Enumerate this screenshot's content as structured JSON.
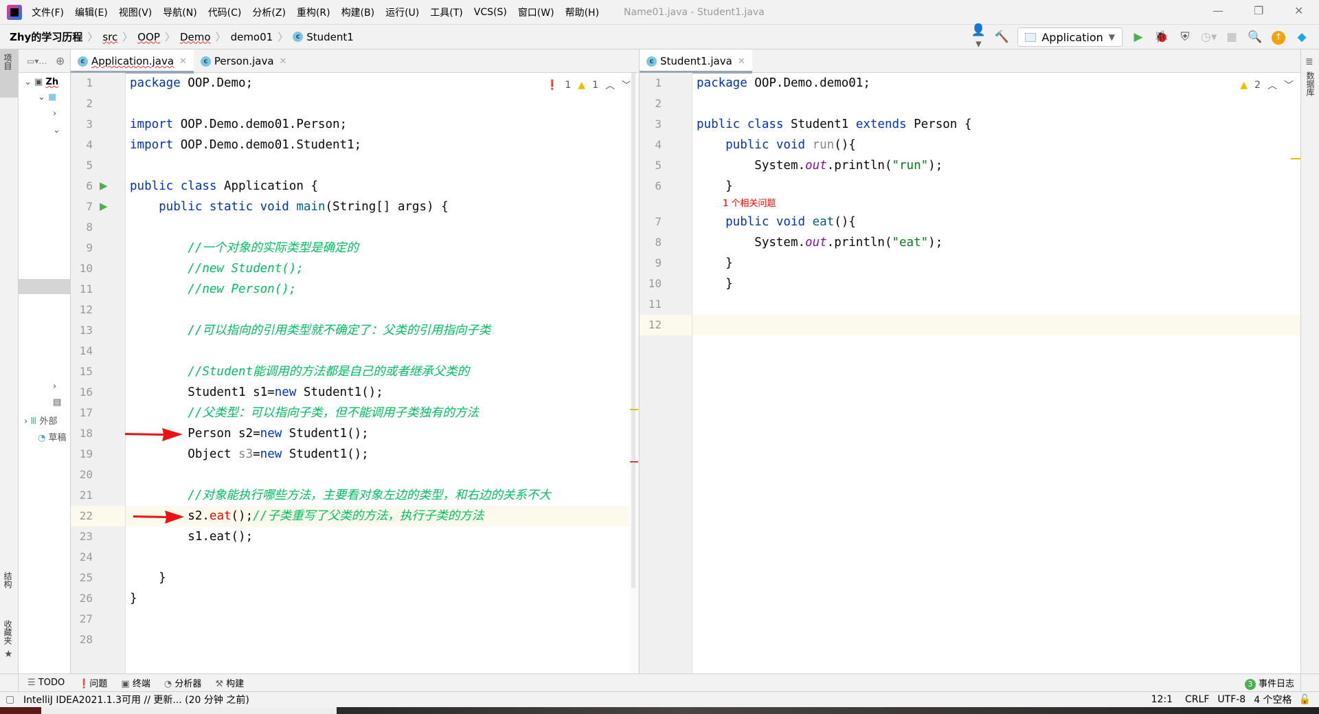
{
  "menu": {
    "items": [
      "文件(F)",
      "编辑(E)",
      "视图(V)",
      "导航(N)",
      "代码(C)",
      "分析(Z)",
      "重构(R)",
      "构建(B)",
      "运行(U)",
      "工具(T)",
      "VCS(S)",
      "窗口(W)",
      "帮助(H)"
    ],
    "window_title": "Name01.java - Student1.java"
  },
  "breadcrumb": [
    "Zhy的学习历程",
    "src",
    "OOP",
    "Demo",
    "demo01",
    "Student1"
  ],
  "toolbar": {
    "run_config": "Application",
    "icons": [
      "user-icon",
      "build-hammer-icon",
      "run-icon",
      "debug-icon",
      "coverage-icon",
      "profile-icon",
      "stop-icon",
      "search-icon",
      "update-icon",
      "toolbox-icon"
    ]
  },
  "left_strip": {
    "project": "项目",
    "structure": "结构",
    "favorites": "收藏夹"
  },
  "right_strip": {
    "database": "数据库"
  },
  "project_tree": {
    "root": "Zh",
    "external": "外部",
    "scratch": "草稿"
  },
  "left_editor": {
    "tabs": [
      {
        "label": "Application.java",
        "active": true
      },
      {
        "label": "Person.java",
        "active": false
      }
    ],
    "errors": "1",
    "warnings": "1",
    "current_line": 22,
    "arrow_lines": [
      18,
      22
    ],
    "lines": [
      [
        [
          "package",
          "kw"
        ],
        [
          " OOP.Demo;",
          ""
        ]
      ],
      [],
      [
        [
          "import",
          "kw"
        ],
        [
          " OOP.Demo.demo01.Person;",
          ""
        ]
      ],
      [
        [
          "import",
          "kw"
        ],
        [
          " OOP.Demo.demo01.Student1;",
          ""
        ]
      ],
      [],
      [
        [
          "public class",
          "kw"
        ],
        [
          " Application {",
          ""
        ]
      ],
      [
        [
          "    public static void",
          "kw"
        ],
        [
          " ",
          ""
        ],
        [
          "main",
          "fn"
        ],
        [
          "(String[] args) {",
          ""
        ]
      ],
      [],
      [
        [
          "        //一个对象的实际类型是确定的",
          "cm"
        ]
      ],
      [
        [
          "        //new Student();",
          "cm"
        ]
      ],
      [
        [
          "        //new Person();",
          "cm"
        ]
      ],
      [],
      [
        [
          "        //可以指向的引用类型就不确定了：父类的引用指向子类",
          "cm"
        ]
      ],
      [],
      [
        [
          "        //Student能调用的方法都是自己的或者继承父类的",
          "cm"
        ]
      ],
      [
        [
          "        Student1 s1=",
          ""
        ],
        [
          "new",
          "kw"
        ],
        [
          " Student1();",
          ""
        ]
      ],
      [
        [
          "        //父类型：可以指向子类，但不能调用子类独有的方法",
          "cm"
        ]
      ],
      [
        [
          "        Person s2=",
          ""
        ],
        [
          "new",
          "kw"
        ],
        [
          " Student1();",
          ""
        ]
      ],
      [
        [
          "        Object ",
          ""
        ],
        [
          "s3",
          "gray"
        ],
        [
          "=",
          ""
        ],
        [
          "new",
          "kw"
        ],
        [
          " Student1();",
          ""
        ]
      ],
      [],
      [
        [
          "        //对象能执行哪些方法，主要看对象左边的类型，和右边的关系不大",
          "cm"
        ]
      ],
      [
        [
          "        s2.",
          ""
        ],
        [
          "eat",
          "red"
        ],
        [
          "();",
          ""
        ],
        [
          "//子类重写了父类的方法，执行子类的方法",
          "cm"
        ]
      ],
      [
        [
          "        s1.eat();",
          ""
        ]
      ],
      [],
      [
        [
          "    }",
          ""
        ]
      ],
      [
        [
          "}",
          ""
        ]
      ],
      [],
      []
    ]
  },
  "right_editor": {
    "tabs": [
      {
        "label": "Student1.java",
        "active": true
      }
    ],
    "warnings": "2",
    "current_line": 12,
    "related_problems": "1 个相关问题",
    "lines": [
      [
        [
          "package",
          "kw"
        ],
        [
          " OOP.Demo.demo01;",
          ""
        ]
      ],
      [],
      [
        [
          "public class",
          "kw"
        ],
        [
          " Student1 ",
          ""
        ],
        [
          "extends",
          "kw"
        ],
        [
          " Person {",
          ""
        ]
      ],
      [
        [
          "    public void",
          "kw"
        ],
        [
          " ",
          ""
        ],
        [
          "run",
          "gray"
        ],
        [
          "(){",
          ""
        ]
      ],
      [
        [
          "        System.",
          ""
        ],
        [
          "out",
          "it"
        ],
        [
          ".println(",
          ""
        ],
        [
          "\"run\"",
          "st"
        ],
        [
          ");",
          ""
        ]
      ],
      [
        [
          "    }",
          ""
        ]
      ],
      [
        [
          "    public void",
          "kw"
        ],
        [
          " ",
          ""
        ],
        [
          "eat",
          "fn"
        ],
        [
          "(){",
          ""
        ]
      ],
      [
        [
          "        System.",
          ""
        ],
        [
          "out",
          "it"
        ],
        [
          ".println(",
          ""
        ],
        [
          "\"eat\"",
          "st"
        ],
        [
          ");",
          ""
        ]
      ],
      [
        [
          "    }",
          ""
        ]
      ],
      [
        [
          "    }",
          ""
        ]
      ],
      [],
      []
    ]
  },
  "bottom_tools": [
    "TODO",
    "问题",
    "终端",
    "分析器",
    "构建"
  ],
  "event_log": {
    "label": "事件日志",
    "count": "3"
  },
  "status": {
    "message": "IntelliJ IDEA2021.1.3可用 // 更新... (20 分钟 之前)",
    "position": "12:1",
    "line_ending": "CRLF",
    "encoding": "UTF-8",
    "indent": "4 个空格"
  },
  "colors": {
    "keyword": "#0033b3",
    "comment": "#00c060",
    "error": "#ff0000",
    "string": "#067d17",
    "arrow": "#ee1111"
  }
}
